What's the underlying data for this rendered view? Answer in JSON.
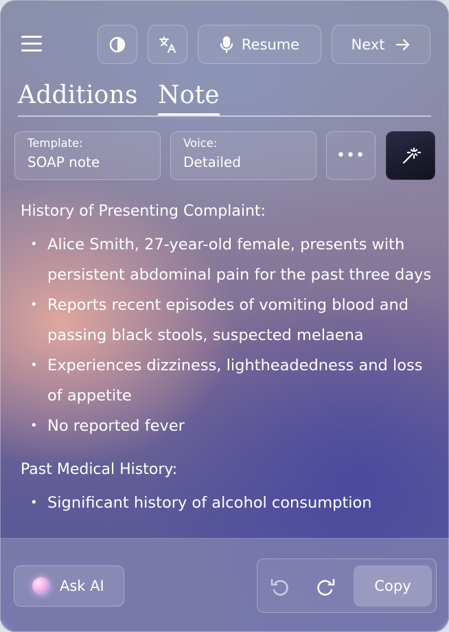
{
  "toolbar": {
    "resume_label": "Resume",
    "next_label": "Next"
  },
  "tabs": [
    {
      "label": "Additions",
      "active": false
    },
    {
      "label": "Note",
      "active": true
    }
  ],
  "selectors": {
    "template": {
      "label": "Template:",
      "value": "SOAP note"
    },
    "voice": {
      "label": "Voice:",
      "value": "Detailed"
    },
    "more_label": "•••"
  },
  "note": {
    "sections": [
      {
        "title": "History of Presenting Complaint:",
        "items": [
          "Alice Smith, 27-year-old female, presents with persistent abdominal pain for the past three days",
          "Reports recent episodes of vomiting blood and passing black stools, suspected melaena",
          "Experiences dizziness, lightheadedness and loss of appetite",
          "No reported fever"
        ]
      },
      {
        "title": "Past Medical History:",
        "items": [
          "Significant history of alcohol consumption"
        ]
      }
    ]
  },
  "bottom": {
    "ask_label": "Ask AI",
    "copy_label": "Copy"
  },
  "icons": {
    "menu": "hamburger-menu-icon",
    "contrast": "contrast-icon",
    "translate": "translate-icon",
    "mic": "microphone-icon",
    "next": "arrow-right-icon",
    "magic": "magic-wand-icon",
    "undo": "undo-icon",
    "redo": "redo-icon"
  }
}
